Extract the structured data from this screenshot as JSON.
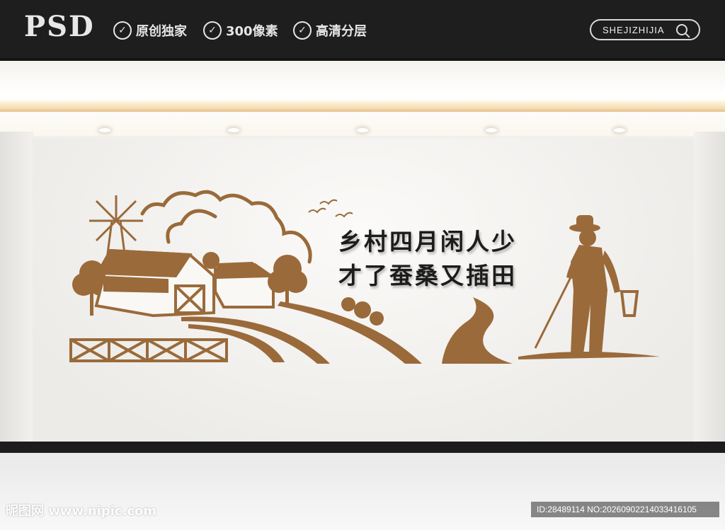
{
  "header": {
    "brand": "PSD",
    "features": [
      "原创独家",
      "300像素",
      "高清分层"
    ],
    "search_label": "SHEJIZHIJIA"
  },
  "slogan": {
    "line1": "乡村四月闲人少",
    "line2": "才了蚕桑又插田"
  },
  "watermark": {
    "site": "昵图网 www.nipic.com",
    "id": "ID:28489114 NO:20260902214033416105"
  },
  "colors": {
    "mural_brown": "#9a6a3a",
    "topbar": "#1e1e1e"
  }
}
